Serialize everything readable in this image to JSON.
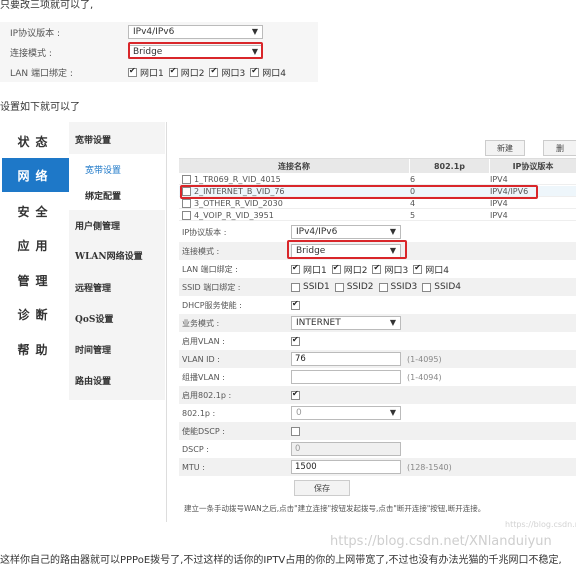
{
  "intro_text": "只要改三项就可以了,",
  "top_config": {
    "rows": [
      {
        "label": "IP协议版本 :",
        "value": "IPv4/IPv6"
      },
      {
        "label": "连接模式 :",
        "value": "Bridge"
      },
      {
        "label": "LAN 端口绑定 :"
      }
    ],
    "ports": [
      "网口1",
      "网口2",
      "网口3",
      "网口4"
    ]
  },
  "setup_text": "设置如下就可以了",
  "nav": {
    "items": [
      "状态",
      "网络",
      "安全",
      "应用",
      "管理",
      "诊断",
      "帮助"
    ],
    "active_index": 1
  },
  "subnav": {
    "items": [
      {
        "label": "宽带设置",
        "kind": "header"
      },
      {
        "label": "宽带设置",
        "kind": "child"
      },
      {
        "label": "绑定配置",
        "kind": "child2"
      },
      {
        "label": "用户侧管理",
        "kind": "header"
      },
      {
        "label": "WLAN网络设置",
        "kind": "header"
      },
      {
        "label": "远程管理",
        "kind": "header"
      },
      {
        "label": "QoS设置",
        "kind": "header"
      },
      {
        "label": "时间管理",
        "kind": "header"
      },
      {
        "label": "路由设置",
        "kind": "header"
      }
    ]
  },
  "toolbar": {
    "new_label": "新建",
    "delete_label": "删"
  },
  "wan_table": {
    "headers": [
      "连接名称",
      "802.1p",
      "IP协议版本"
    ],
    "rows": [
      {
        "name": "1_TR069_R_VID_4015",
        "p": "6",
        "ip": "IPV4"
      },
      {
        "name": "2_INTERNET_B_VID_76",
        "p": "0",
        "ip": "IPV4/IPV6"
      },
      {
        "name": "3_OTHER_R_VID_2030",
        "p": "4",
        "ip": "IPV4"
      },
      {
        "name": "4_VOIP_R_VID_3951",
        "p": "5",
        "ip": "IPV4"
      }
    ]
  },
  "form": {
    "ip_version_label": "IP协议版本 :",
    "ip_version_value": "IPv4/IPv6",
    "mode_label": "连接模式 :",
    "mode_value": "Bridge",
    "lan_label": "LAN 端口绑定 :",
    "lan_ports": [
      "网口1",
      "网口2",
      "网口3",
      "网口4"
    ],
    "ssid_label": "SSID 端口绑定 :",
    "ssids": [
      "SSID1",
      "SSID2",
      "SSID3",
      "SSID4"
    ],
    "dhcp_label": "DHCP服务使能 :",
    "service_label": "业务模式 :",
    "service_value": "INTERNET",
    "vlan_enable_label": "启用VLAN :",
    "vlan_id_label": "VLAN ID :",
    "vlan_id_value": "76",
    "vlan_id_hint": "(1-4095)",
    "multicast_vlan_label": "组播VLAN :",
    "multicast_vlan_hint": "(1-4094)",
    "e8021p_label": "启用802.1p :",
    "p8021_label": "802.1p :",
    "p8021_value": "0",
    "dscp_enable_label": "使能DSCP :",
    "dscp_label": "DSCP :",
    "dscp_value": "0",
    "mtu_label": "MTU :",
    "mtu_value": "1500",
    "mtu_hint": "(128-1540)",
    "save_label": "保存"
  },
  "note": "建立一条手动拨号WAN之后,点击\"建立连接\"按钮发起拨号,点击\"断开连接\"按钮,断开连接。",
  "bottom_text": "这样你自己的路由器就可以PPPoE拨号了,不过这样的话你的IPTV占用的你的上网带宽了,不过也没有办法光猫的千兆网口不稳定,",
  "watermark_small": "https://blog.csdn.ne",
  "watermark": "https://blog.csdn.net/XNlanduiyun"
}
